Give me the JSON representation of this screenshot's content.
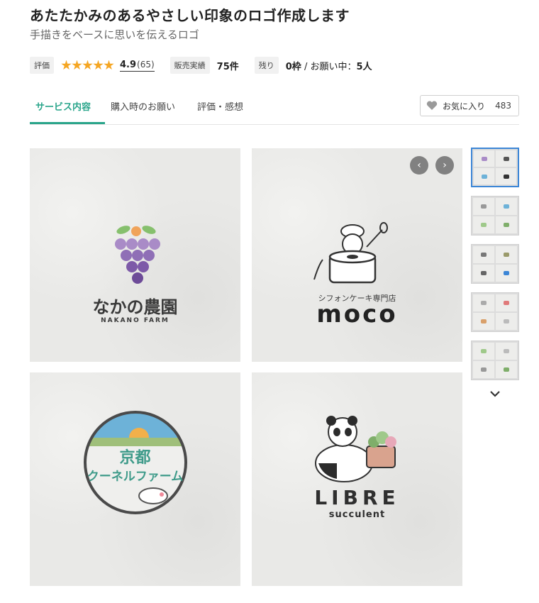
{
  "header": {
    "title": "あたたかみのあるやさしい印象のロゴ作成します",
    "subtitle": "手描きをベースに思いを伝えるロゴ"
  },
  "meta": {
    "rating_label": "評価",
    "rating_value": "4.9",
    "rating_count": "(65)",
    "stars": 5,
    "sales_label": "販売実績",
    "sales_value": "75件",
    "remain_label": "残り",
    "remain_value": "0枠",
    "remain_rest": " / お願い中：",
    "remain_people": "5人"
  },
  "tabs": [
    {
      "label": "サービス内容",
      "active": true
    },
    {
      "label": "購入時のお願い",
      "active": false
    },
    {
      "label": "評価・感想",
      "active": false
    }
  ],
  "favorite": {
    "label": "お気に入り",
    "count": "483"
  },
  "gallery": {
    "tiles": [
      {
        "jp": "なかの農園",
        "en": "NAKANO FARM"
      },
      {
        "jp": "シフォンケーキ専門店",
        "en": "moco"
      },
      {
        "jp": "京都",
        "en": "クーネルファーム"
      },
      {
        "jp": "LIBRE",
        "en": "succulent"
      }
    ],
    "prev_icon": "‹",
    "next_icon": "›",
    "thumbs_down_icon": "⌄"
  },
  "colors": {
    "accent": "#2aa58b",
    "star": "#f5a623",
    "thumb_selected": "#3c86d6"
  },
  "icons": [
    "star-icon",
    "heart-icon",
    "chevron-left-icon",
    "chevron-right-icon",
    "chevron-down-icon"
  ]
}
